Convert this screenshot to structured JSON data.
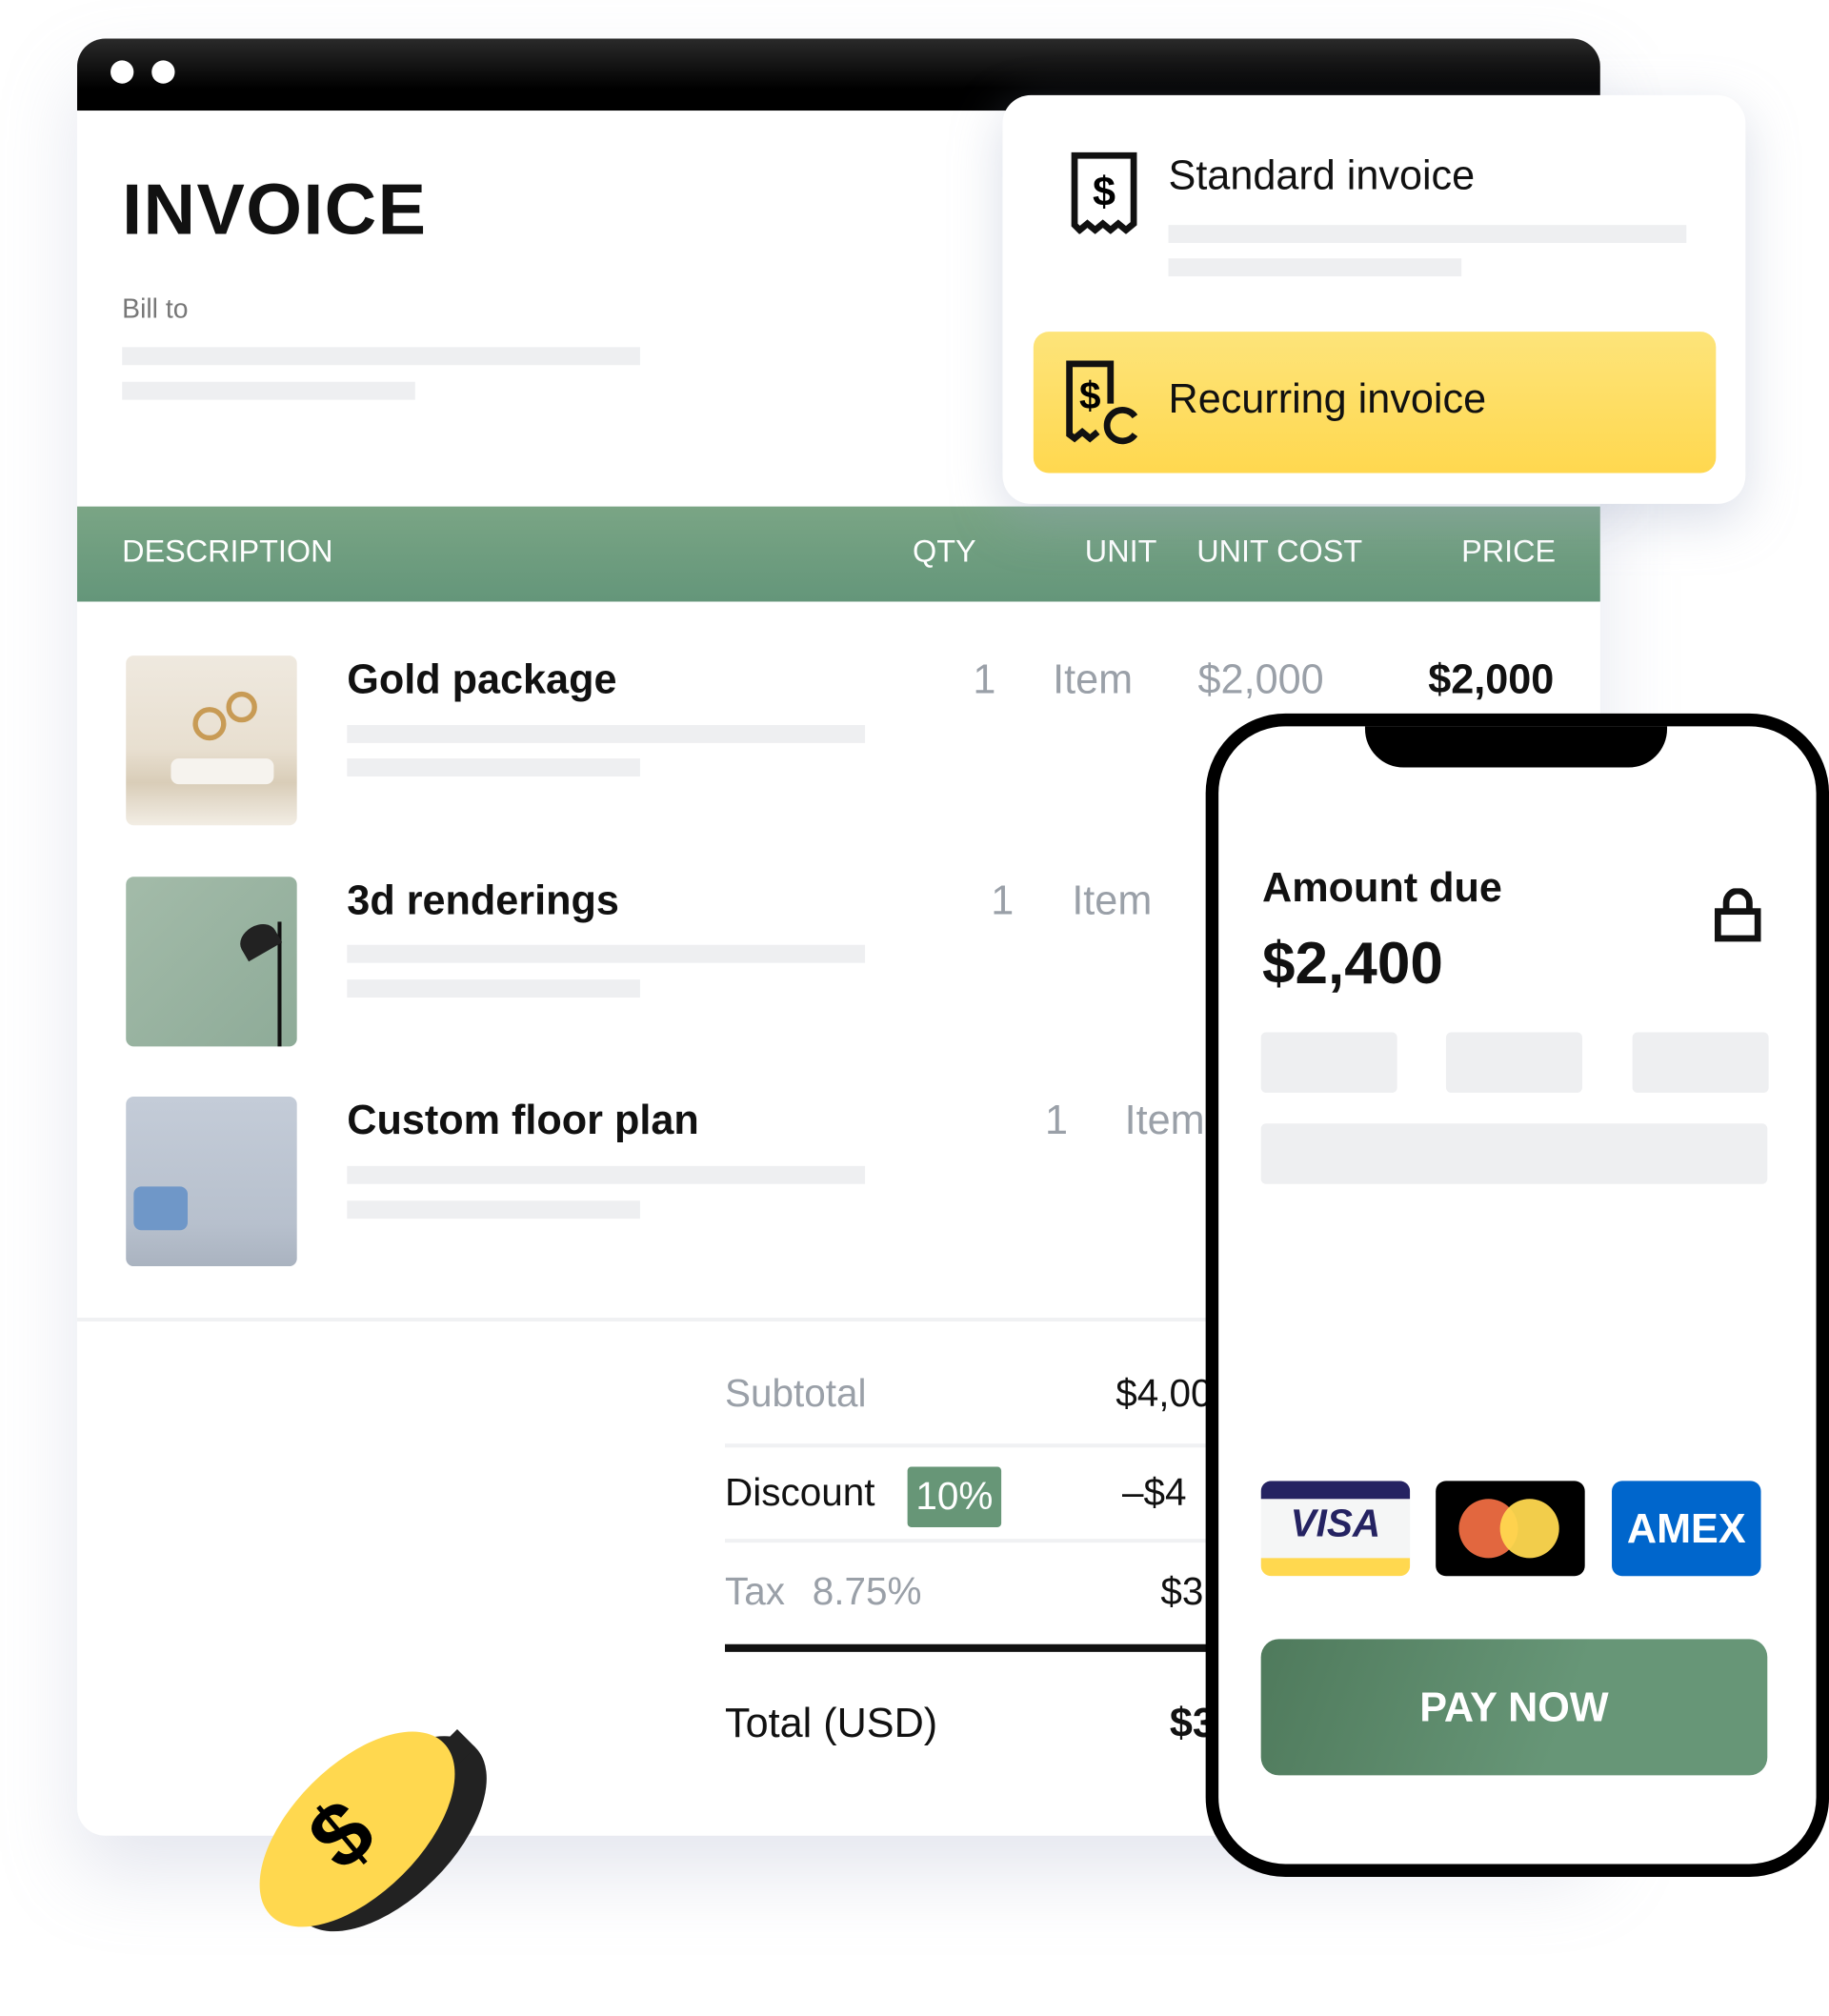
{
  "invoice": {
    "title": "INVOICE",
    "bill_to_label": "Bill to"
  },
  "invoice_types": {
    "standard": "Standard invoice",
    "recurring": "Recurring invoice",
    "selected": "recurring"
  },
  "table": {
    "headers": [
      "DESCRIPTION",
      "QTY",
      "UNIT",
      "UNIT COST",
      "PRICE"
    ],
    "rows": [
      {
        "name": "Gold package",
        "qty": "1",
        "unit": "Item",
        "unit_cost": "$2,000",
        "price": "$2,000"
      },
      {
        "name": "3d renderings",
        "qty": "1",
        "unit": "Item"
      },
      {
        "name": "Custom floor plan",
        "qty": "1",
        "unit": "Item"
      }
    ]
  },
  "summary": {
    "subtotal_label": "Subtotal",
    "subtotal_value": "$4,00",
    "discount_label": "Discount",
    "discount_badge": "10%",
    "discount_value": "–$4",
    "tax_label": "Tax",
    "tax_rate": "8.75%",
    "tax_value": "$3",
    "total_label": "Total (USD)",
    "total_value": "$3"
  },
  "payment": {
    "amount_due_label": "Amount due",
    "amount_due": "$2,400",
    "cards": [
      "VISA",
      "Mastercard",
      "AMEX"
    ],
    "visa_label": "VISA",
    "amex_label": "AMEX",
    "pay_button": "PAY NOW"
  },
  "colors": {
    "green": "#679677",
    "yellow": "#ffd84f",
    "amex": "#0066cc",
    "visa_navy": "#252362"
  }
}
